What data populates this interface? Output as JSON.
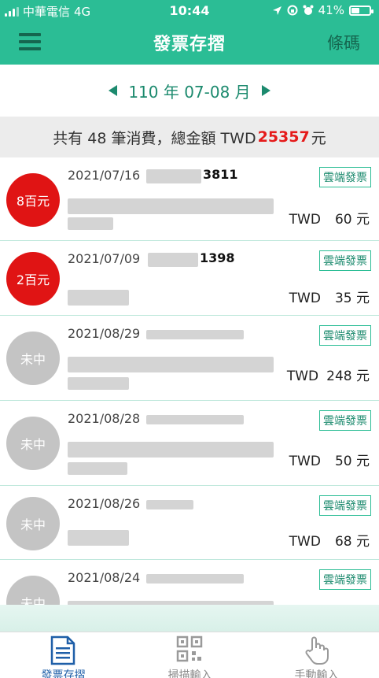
{
  "status": {
    "carrier": "中華電信",
    "network": "4G",
    "time": "10:44",
    "battery": "41%"
  },
  "header": {
    "title": "發票存摺",
    "right_action": "條碼"
  },
  "period": {
    "label": "110 年 07-08 月"
  },
  "summary": {
    "prefix": "共有 48 筆消費，總金額 TWD",
    "amount": "25357",
    "suffix": "元",
    "amount_color": "#e51a1a"
  },
  "invoices": [
    {
      "badge": "8百元",
      "status": "win",
      "date": "2021/07/16",
      "number_tail": "3811",
      "tag": "雲端發票",
      "currency": "TWD",
      "amount": "60 元"
    },
    {
      "badge": "2百元",
      "status": "win",
      "date": "2021/07/09",
      "number_tail": "1398",
      "tag": "雲端發票",
      "currency": "TWD",
      "amount": "35 元"
    },
    {
      "badge": "未中",
      "status": "lose",
      "date": "2021/08/29",
      "number_tail": "",
      "tag": "雲端發票",
      "currency": "TWD",
      "amount": "248 元"
    },
    {
      "badge": "未中",
      "status": "lose",
      "date": "2021/08/28",
      "number_tail": "",
      "tag": "雲端發票",
      "currency": "TWD",
      "amount": "50 元"
    },
    {
      "badge": "未中",
      "status": "lose",
      "date": "2021/08/26",
      "number_tail": "",
      "tag": "雲端發票",
      "currency": "TWD",
      "amount": "68 元"
    },
    {
      "badge": "未中",
      "status": "lose",
      "date": "2021/08/24",
      "number_tail": "",
      "tag": "雲端發票",
      "currency": "",
      "amount": ""
    }
  ],
  "tabs": [
    {
      "label": "發票存摺",
      "icon": "document-icon",
      "active": true
    },
    {
      "label": "掃描輸入",
      "icon": "qr-code-icon",
      "active": false
    },
    {
      "label": "手動輸入",
      "icon": "hand-pointer-icon",
      "active": false
    }
  ],
  "colors": {
    "brand": "#2bbd95",
    "accent_dark": "#1c8a6e",
    "win": "#e01414",
    "lose": "#c4c4c4",
    "tab_active": "#1f5fa8"
  }
}
